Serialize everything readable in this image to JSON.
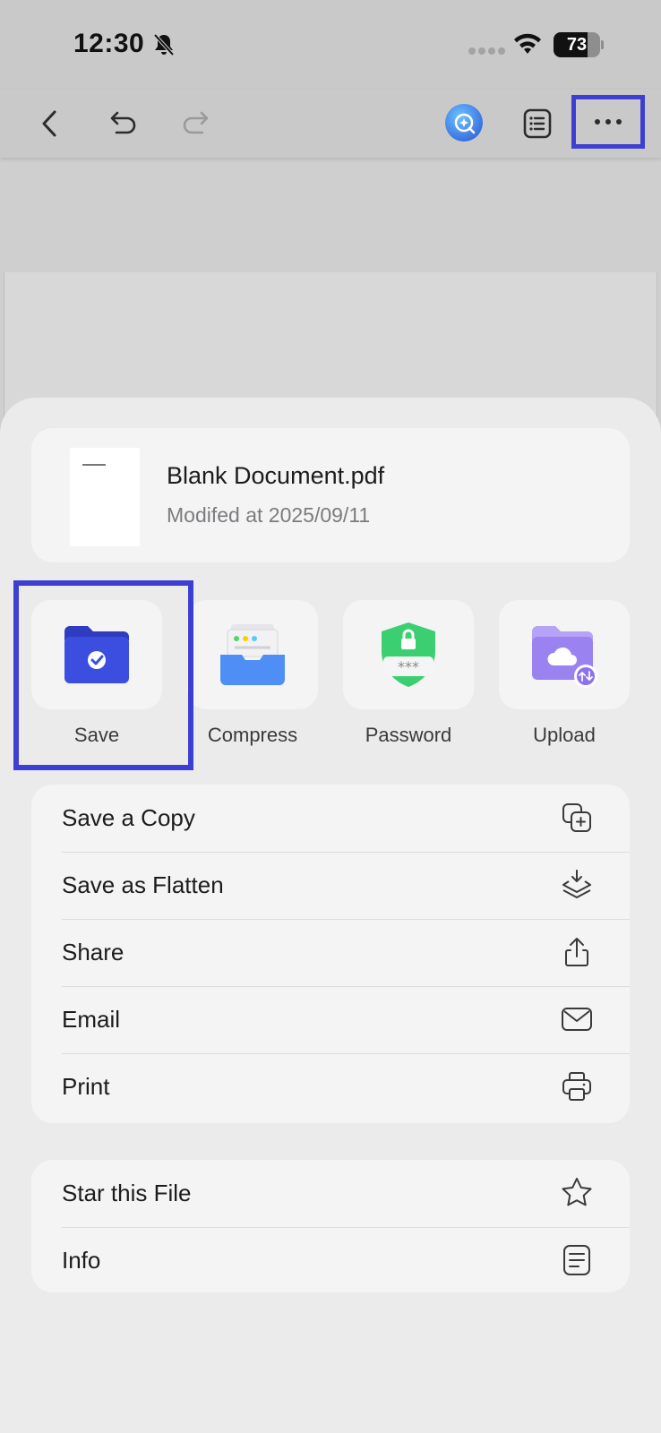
{
  "status_bar": {
    "time": "12:30",
    "battery_level": "73",
    "battery_fraction": 0.73
  },
  "toolbar": {
    "icons": [
      "back-icon",
      "undo-icon",
      "redo-icon",
      "ai-assistant-icon",
      "outline-icon",
      "more-icon"
    ]
  },
  "file": {
    "name": "Blank Document.pdf",
    "modified": "Modifed at 2025/09/11"
  },
  "quick_actions": [
    {
      "label": "Save",
      "icon": "folder-check-icon"
    },
    {
      "label": "Compress",
      "icon": "archive-box-icon"
    },
    {
      "label": "Password",
      "icon": "shield-lock-icon"
    },
    {
      "label": "Upload",
      "icon": "cloud-folder-icon"
    }
  ],
  "menu": [
    {
      "label": "Save a Copy",
      "icon": "copy-plus-icon"
    },
    {
      "label": "Save as Flatten",
      "icon": "layers-download-icon"
    },
    {
      "label": "Share",
      "icon": "share-icon"
    },
    {
      "label": "Email",
      "icon": "envelope-icon"
    },
    {
      "label": "Print",
      "icon": "printer-icon"
    }
  ],
  "menu2": [
    {
      "label": "Star this File",
      "icon": "star-icon"
    },
    {
      "label": "Info",
      "icon": "document-info-icon"
    }
  ],
  "colors": {
    "highlight": "#3d3fd2",
    "save_folder": "#3b4ee0",
    "password_shield": "#3ccf72",
    "upload_folder": "#9a82f0"
  }
}
